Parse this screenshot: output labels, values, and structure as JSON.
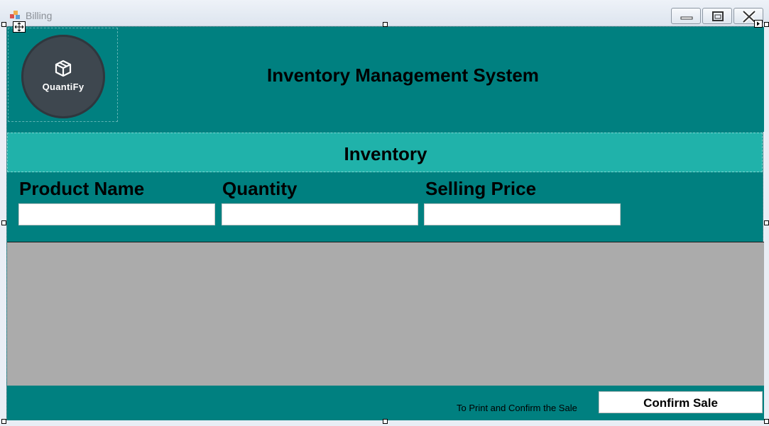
{
  "window": {
    "title": "Billing"
  },
  "header": {
    "title": "Inventory Management System",
    "logo_text": "QuantiFy"
  },
  "section": {
    "title": "Inventory"
  },
  "fields": [
    {
      "label": "Product Name",
      "value": ""
    },
    {
      "label": "Quantity",
      "value": ""
    },
    {
      "label": "Selling Price",
      "value": ""
    }
  ],
  "footer": {
    "note": "To Print and Confirm the Sale",
    "confirm_label": "Confirm Sale"
  },
  "colors": {
    "teal": "#008080",
    "light_teal": "#20b2aa",
    "grid_gray": "#ababab",
    "logo_dark": "#3e474f"
  },
  "icons": {
    "app": "app-icon",
    "minimize": "minimize-icon",
    "maximize": "maximize-icon",
    "close": "close-icon",
    "logo": "box-icon"
  }
}
